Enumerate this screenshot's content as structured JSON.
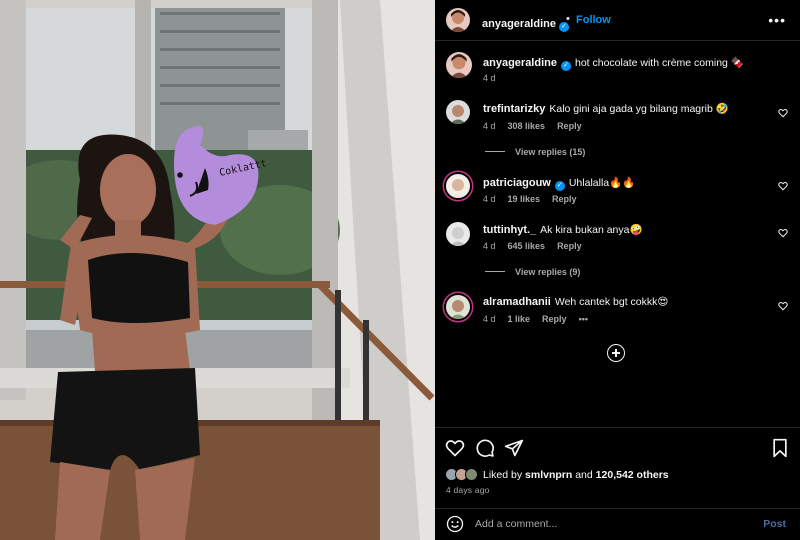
{
  "photo": {
    "sticker_text": "Coklattt",
    "description_icon": "photo"
  },
  "post_header": {
    "username": "anyageraldine",
    "separator": "•",
    "follow_label": "Follow",
    "more_icon": "ellipsis-icon"
  },
  "caption": {
    "username": "anyageraldine",
    "text": "hot chocolate with crème coming 🍫",
    "time": "4 d"
  },
  "comments": [
    {
      "username": "trefintarizky",
      "text": "Kalo gini aja gada yg bilang magrib 🤣",
      "time": "4 d",
      "likes": "308 likes",
      "reply": "Reply",
      "view_replies": "View replies (15)"
    },
    {
      "username": "patriciagouw",
      "text": "Uhlalalla🔥🔥",
      "time": "4 d",
      "likes": "19 likes",
      "reply": "Reply",
      "verified": true
    },
    {
      "username": "tuttinhyt._",
      "text": "Ak kira bukan anya🤪",
      "time": "4 d",
      "likes": "645 likes",
      "reply": "Reply",
      "view_replies": "View replies (9)"
    },
    {
      "username": "alramadhanii",
      "text": "Weh cantek bgt cokkk😍",
      "time": "4 d",
      "likes": "1 like",
      "reply": "Reply",
      "more": "•••"
    }
  ],
  "actions": {
    "liked_by_prefix": "Liked by",
    "liked_by_user": "smlvnprn",
    "liked_by_and": "and",
    "liked_count": "120,542 others",
    "time_ago": "4 days ago"
  },
  "add_comment": {
    "placeholder": "Add a comment...",
    "post_label": "Post"
  },
  "colors": {
    "accent": "#0095f6",
    "muted": "#a8a8a8",
    "background": "#000000",
    "sticker_purple": "#b38ddc"
  }
}
